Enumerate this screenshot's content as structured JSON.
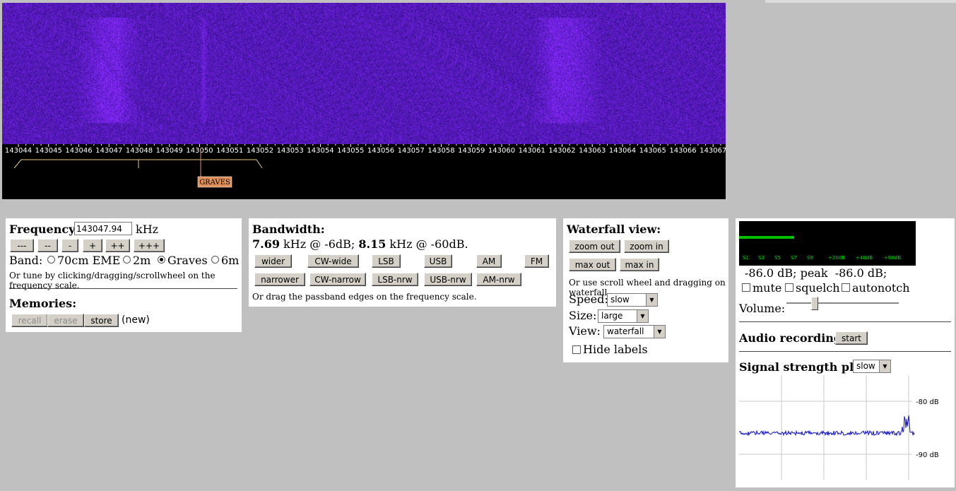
{
  "waterfall": {
    "scale_labels": [
      "143044",
      "143045",
      "143046",
      "143047",
      "143048",
      "143049",
      "143050",
      "143051",
      "143052",
      "143053",
      "143054",
      "143055",
      "143056",
      "143057",
      "143058",
      "143059",
      "143060",
      "143061",
      "143062",
      "143063",
      "143064",
      "143065",
      "143066",
      "143067"
    ],
    "marker_label": "GRAVES",
    "colors": {
      "background": "#3a1a9e",
      "marker_fill": "#e0905a"
    }
  },
  "frequency": {
    "label": "Frequency:",
    "value": "143047.94",
    "unit": "kHz",
    "step_buttons": [
      "---",
      "--",
      "-",
      "+",
      "++",
      "+++"
    ],
    "band_label": "Band:",
    "bands": [
      {
        "label": "70cm EME",
        "selected": false
      },
      {
        "label": "2m",
        "selected": false
      },
      {
        "label": "Graves",
        "selected": true
      },
      {
        "label": "6m",
        "selected": false
      }
    ],
    "hint": "Or tune by clicking/dragging/scrollwheel on the frequency scale."
  },
  "memories": {
    "title": "Memories:",
    "recall": "recall",
    "erase": "erase",
    "store": "store",
    "status": "(new)"
  },
  "bandwidth": {
    "title": "Bandwidth:",
    "v1": "7.69",
    "t1": " kHz @ -6dB; ",
    "v2": "8.15",
    "t2": " kHz @ -60dB.",
    "row1": [
      "wider",
      "CW-wide",
      "LSB",
      "USB",
      "AM",
      "FM"
    ],
    "row2": [
      "narrower",
      "CW-narrow",
      "LSB-nrw",
      "USB-nrw",
      "AM-nrw"
    ],
    "hint": "Or drag the passband edges on the frequency scale."
  },
  "waterfall_view": {
    "title": "Waterfall view:",
    "zoom_out": "zoom out",
    "zoom_in": "zoom in",
    "max_out": "max out",
    "max_in": "max in",
    "hint": "Or use scroll wheel and dragging on waterfall.",
    "speed_label": "Speed:",
    "speed_value": "slow",
    "size_label": "Size:",
    "size_value": "large",
    "view_label": "View:",
    "view_value": "waterfall",
    "hide_labels": "Hide labels"
  },
  "smeter": {
    "scale": [
      "S1",
      "S3",
      "S5",
      "S7",
      "S9",
      "+20dB",
      "+40dB",
      "+60dB"
    ],
    "level_fraction": 0.31,
    "reading": "-86.0 dB; peak  -86.0 dB;",
    "mute": "mute",
    "squelch": "squelch",
    "autonotch": "autonotch",
    "volume_label": "Volume:",
    "volume_fraction": 0.25,
    "colors": {
      "bar": "#00c000",
      "text": "#00e000"
    }
  },
  "audio": {
    "title": "Audio recording:",
    "start": "start"
  },
  "signal_plot": {
    "title": "Signal strength plot:",
    "speed_value": "slow",
    "label_top": "-80 dB",
    "label_bottom": "-90 dB",
    "colors": {
      "trace": "#1010c0",
      "grid": "#c8c8c8"
    }
  }
}
